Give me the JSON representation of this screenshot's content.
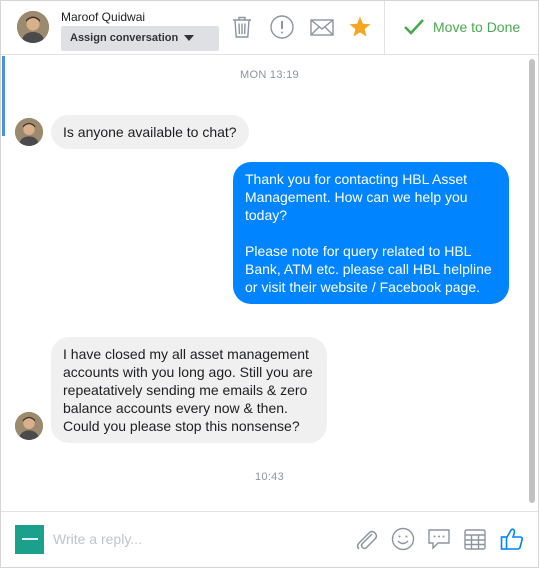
{
  "header": {
    "contact_name": "Maroof Quidwai",
    "assign_label": "Assign conversation",
    "done_label": "Move to Done"
  },
  "icons": {
    "delete": "trash-icon",
    "spam": "alert-circle-icon",
    "unread": "envelope-icon",
    "follow_up": "star-icon",
    "done": "checkmark-icon",
    "attach": "paperclip-icon",
    "emoji": "smiley-icon",
    "saved_replies": "chat-bubble-icon",
    "appointment": "calendar-icon",
    "like": "thumbs-up-icon"
  },
  "colors": {
    "accent_blue": "#0084ff",
    "done_green": "#4aa94e",
    "star_orange": "#f5a623",
    "incoming_bubble": "#f1f0f0"
  },
  "thread": {
    "timestamp_top": "MON 13:19",
    "msg1": "Is anyone available to chat?",
    "reply_p1": "Thank you for contacting HBL Asset Management. How can we help you today?",
    "reply_p2": "Please note for query related to HBL Bank, ATM etc. please call HBL helpline or visit their website / Facebook page.",
    "msg2": "I have closed my all asset management accounts with you long ago. Still you are repeatatively sending me emails & zero balance accounts every now & then. Could you please stop this nonsense?",
    "timestamp_bottom": "10:43"
  },
  "composer": {
    "placeholder": "Write a reply..."
  }
}
